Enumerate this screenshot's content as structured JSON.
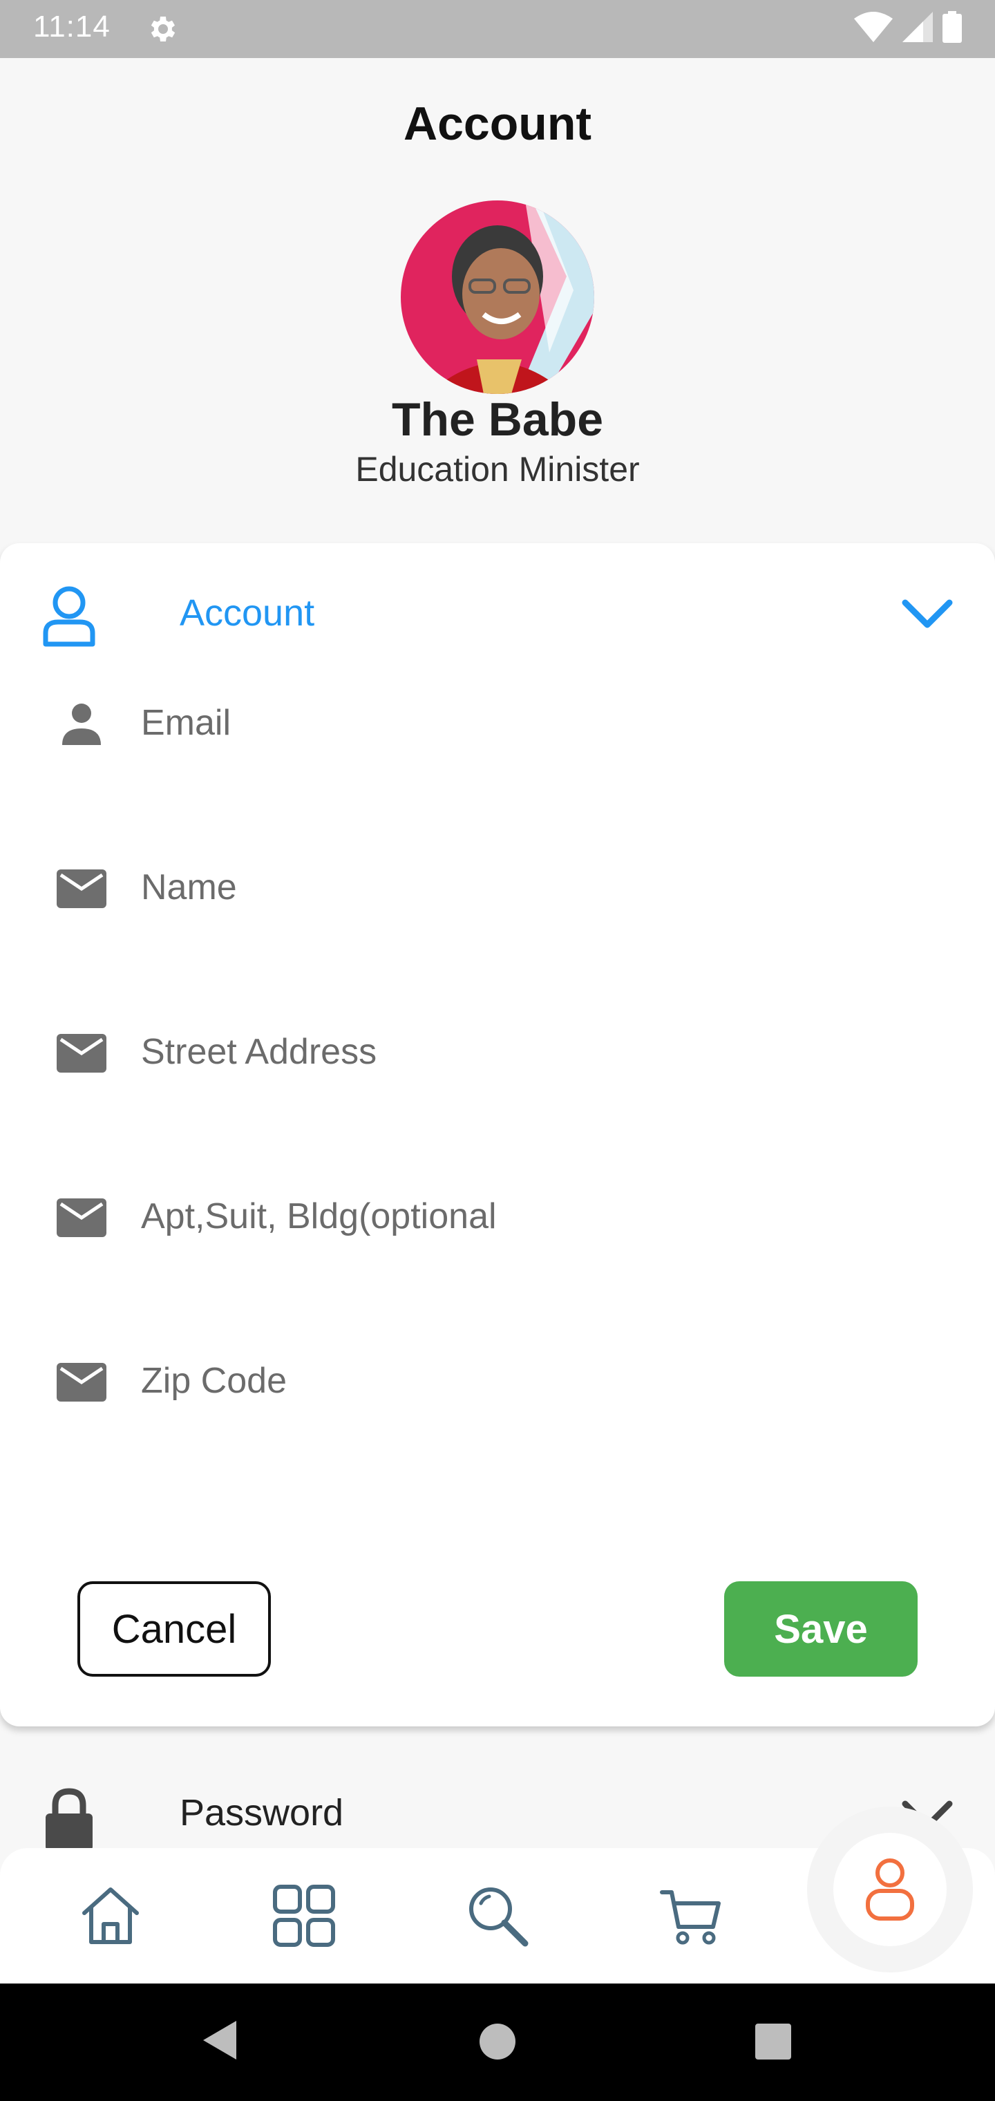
{
  "status_bar": {
    "time": "11:14"
  },
  "header": {
    "title": "Account",
    "profile_name": "The Babe",
    "profile_role": "Education Minister"
  },
  "account_section": {
    "title": "Account",
    "fields": [
      {
        "icon": "person-icon",
        "placeholder": "Email"
      },
      {
        "icon": "mail-icon",
        "placeholder": "Name"
      },
      {
        "icon": "mail-icon",
        "placeholder": "Street Address"
      },
      {
        "icon": "mail-icon",
        "placeholder": "Apt,Suit, Bldg(optional"
      },
      {
        "icon": "mail-icon",
        "placeholder": "Zip Code"
      }
    ],
    "cancel_label": "Cancel",
    "save_label": "Save"
  },
  "password_section": {
    "title": "Password"
  },
  "bottom_nav": {
    "items": [
      "home-icon",
      "grid-icon",
      "search-icon",
      "cart-icon",
      "profile-icon"
    ],
    "active": "profile-icon"
  },
  "colors": {
    "accent": "#2196f3",
    "save": "#4caf50",
    "active_nav": "#f2703f",
    "nav_icon": "#4a6b80"
  }
}
